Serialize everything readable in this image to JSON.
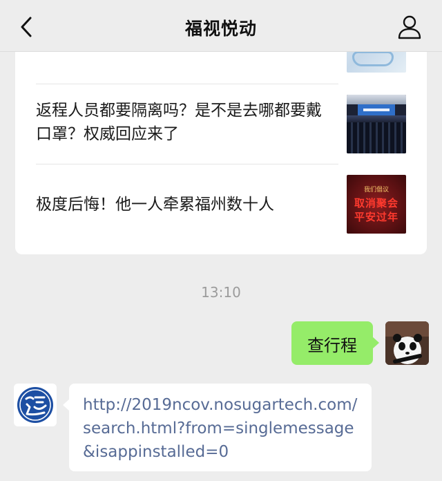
{
  "header": {
    "title": "福视悦动",
    "back_icon": "chevron-left-icon",
    "profile_icon": "person-icon"
  },
  "articles": [
    {
      "title": "返程人员都要隔离吗？是不是去哪都要戴口罩？权威回应来了",
      "thumbnail": "meeting-photo"
    },
    {
      "title": "极度后悔！他一人牵累福州数十人",
      "thumbnail": "red-poster",
      "thumb_line1": "我们倡议",
      "thumb_line2": "取消聚会",
      "thumb_line3": "平安过年"
    }
  ],
  "chat": {
    "timestamp": "13:10",
    "my_message": "查行程",
    "bot_link": "http://2019ncov.nosugartech.com/search.html?from=singlemessage&isappinstalled=0"
  },
  "colors": {
    "background": "#ededed",
    "my_bubble": "#95ec69",
    "link": "#576b95",
    "bot_avatar_blue": "#1d4fa3"
  }
}
